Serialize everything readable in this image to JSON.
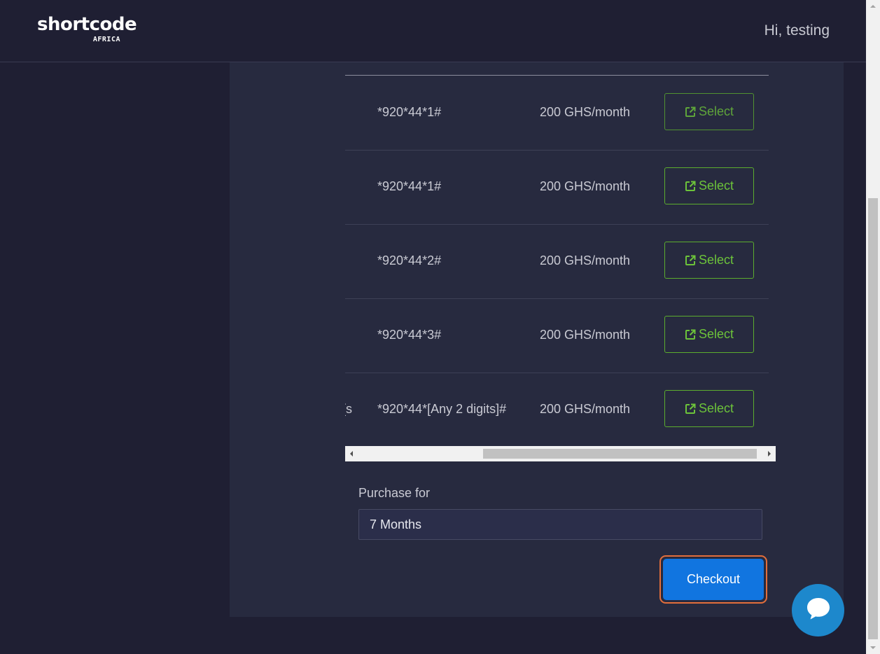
{
  "header": {
    "logo_main": "shortcode",
    "logo_sub": "AFRICA",
    "greeting": "Hi, testing"
  },
  "table": {
    "rows": [
      {
        "label_fragment": "",
        "code": "*920*44*1#",
        "price": "200 GHS/month",
        "action": "Select"
      },
      {
        "label_fragment": "",
        "code": "*920*44*1#",
        "price": "200 GHS/month",
        "action": "Select"
      },
      {
        "label_fragment": "",
        "code": "*920*44*2#",
        "price": "200 GHS/month",
        "action": "Select"
      },
      {
        "label_fragment": "",
        "code": "*920*44*3#",
        "price": "200 GHS/month",
        "action": "Select"
      },
      {
        "label_fragment": "s]",
        "code": "*920*44*[Any 2 digits]#",
        "price": "200 GHS/month",
        "action": "Select"
      }
    ]
  },
  "purchase": {
    "label": "Purchase for",
    "selected": "7 Months"
  },
  "checkout": {
    "label": "Checkout"
  },
  "colors": {
    "background": "#1f1f33",
    "panel": "#272a3f",
    "select_green": "#6cc33a",
    "checkout_blue": "#1175e0",
    "focus_ring": "#e36e3b",
    "chat_blue": "#1d88cc"
  },
  "icons": {
    "select": "external-link-icon",
    "chat": "chat-bubble-icon"
  }
}
